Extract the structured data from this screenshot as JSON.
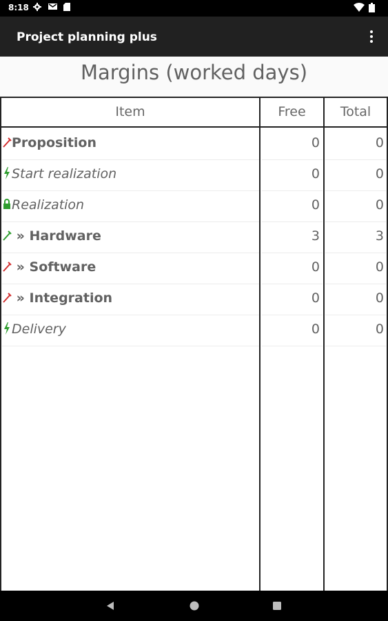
{
  "status": {
    "time": "8:18",
    "left_icons": [
      "gear-icon",
      "mail-icon",
      "sd-card-icon"
    ],
    "right_icons": [
      "wifi-icon",
      "battery-icon"
    ]
  },
  "app_bar": {
    "title": "Project planning plus",
    "menu_icon": "overflow-menu-icon"
  },
  "page_title": "Margins (worked days)",
  "table": {
    "headers": {
      "item": "Item",
      "free": "Free",
      "total": "Total"
    },
    "rows": [
      {
        "label": "Proposition",
        "icon": "tools-icon",
        "icon_color": "#d32f2f",
        "style": "bold",
        "free": "0",
        "total": "0"
      },
      {
        "label": "Start realization",
        "icon": "lightning-icon",
        "icon_color": "#2e9d2e",
        "style": "italic",
        "free": "0",
        "total": "0"
      },
      {
        "label": "Realization",
        "icon": "lock-icon",
        "icon_color": "#2e9d2e",
        "style": "italic",
        "free": "0",
        "total": "0"
      },
      {
        "label": " » Hardware",
        "icon": "tools-icon",
        "icon_color": "#2e9d2e",
        "style": "bold",
        "free": "3",
        "total": "3"
      },
      {
        "label": " » Software",
        "icon": "tools-icon",
        "icon_color": "#d32f2f",
        "style": "bold",
        "free": "0",
        "total": "0"
      },
      {
        "label": " » Integration",
        "icon": "tools-icon",
        "icon_color": "#d32f2f",
        "style": "bold",
        "free": "0",
        "total": "0"
      },
      {
        "label": "Delivery",
        "icon": "lightning-icon",
        "icon_color": "#2e9d2e",
        "style": "italic",
        "free": "0",
        "total": "0"
      }
    ]
  },
  "nav": {
    "back": "back-icon",
    "home": "home-icon",
    "recents": "recents-icon"
  }
}
